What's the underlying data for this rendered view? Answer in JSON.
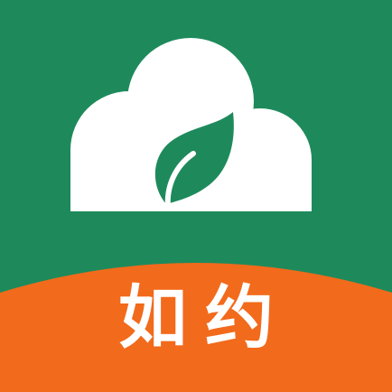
{
  "app_icon": {
    "brand_name": "如约",
    "colors": {
      "background_green": "#1E8A5C",
      "band_orange": "#F26A1B",
      "cloud_white": "#FFFFFF",
      "leaf_green": "#1E8A5C"
    },
    "icons": {
      "cloud": "cloud-icon",
      "leaf": "leaf-icon"
    }
  }
}
